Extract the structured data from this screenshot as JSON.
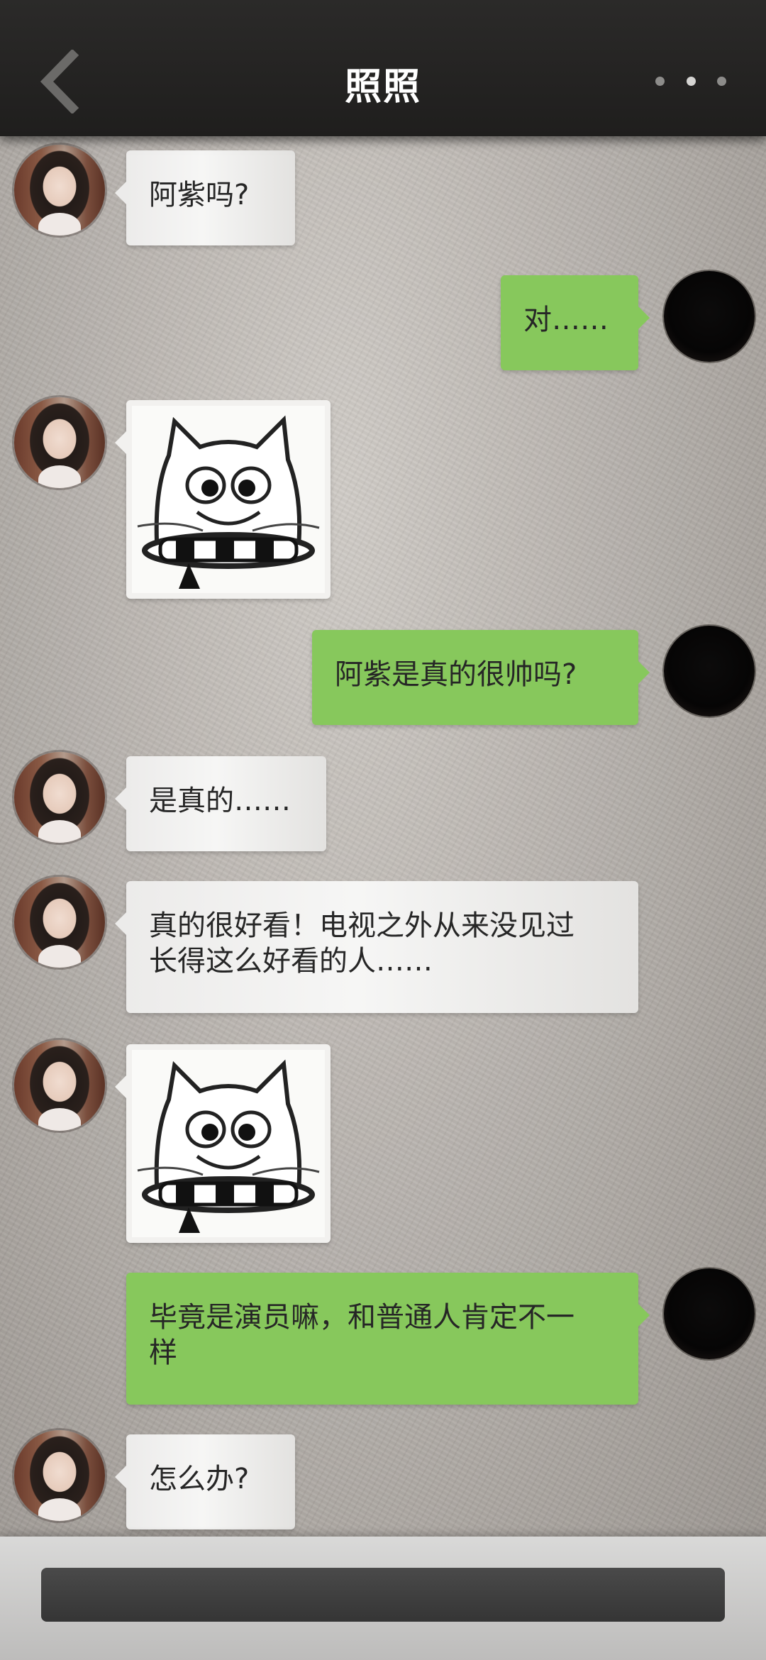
{
  "header": {
    "title": "照照",
    "back_icon": "chevron-left-icon",
    "more_icon": "more-dots-icon"
  },
  "messages": [
    {
      "side": "left",
      "type": "text",
      "text": "阿紫吗?"
    },
    {
      "side": "right",
      "type": "text",
      "text": "对……"
    },
    {
      "side": "left",
      "type": "sticker",
      "sticker": "cartoon-cat-crying-sticker"
    },
    {
      "side": "right",
      "type": "text",
      "text": "阿紫是真的很帅吗?"
    },
    {
      "side": "left",
      "type": "text",
      "text": "是真的……"
    },
    {
      "side": "left",
      "type": "text",
      "text": "真的很好看！电视之外从来没见过\n长得这么好看的人……"
    },
    {
      "side": "left",
      "type": "sticker",
      "sticker": "cartoon-cat-crying-sticker"
    },
    {
      "side": "right",
      "type": "text",
      "text": "毕竟是演员嘛，和普通人肯定不一\n样"
    },
    {
      "side": "left",
      "type": "text",
      "text": "怎么办?"
    }
  ],
  "input": {
    "value": "",
    "placeholder": ""
  },
  "colors": {
    "header_bg": "#232221",
    "sent_bubble": "#87c85c",
    "received_bubble": "#f0efee",
    "input_bg": "#404040"
  }
}
